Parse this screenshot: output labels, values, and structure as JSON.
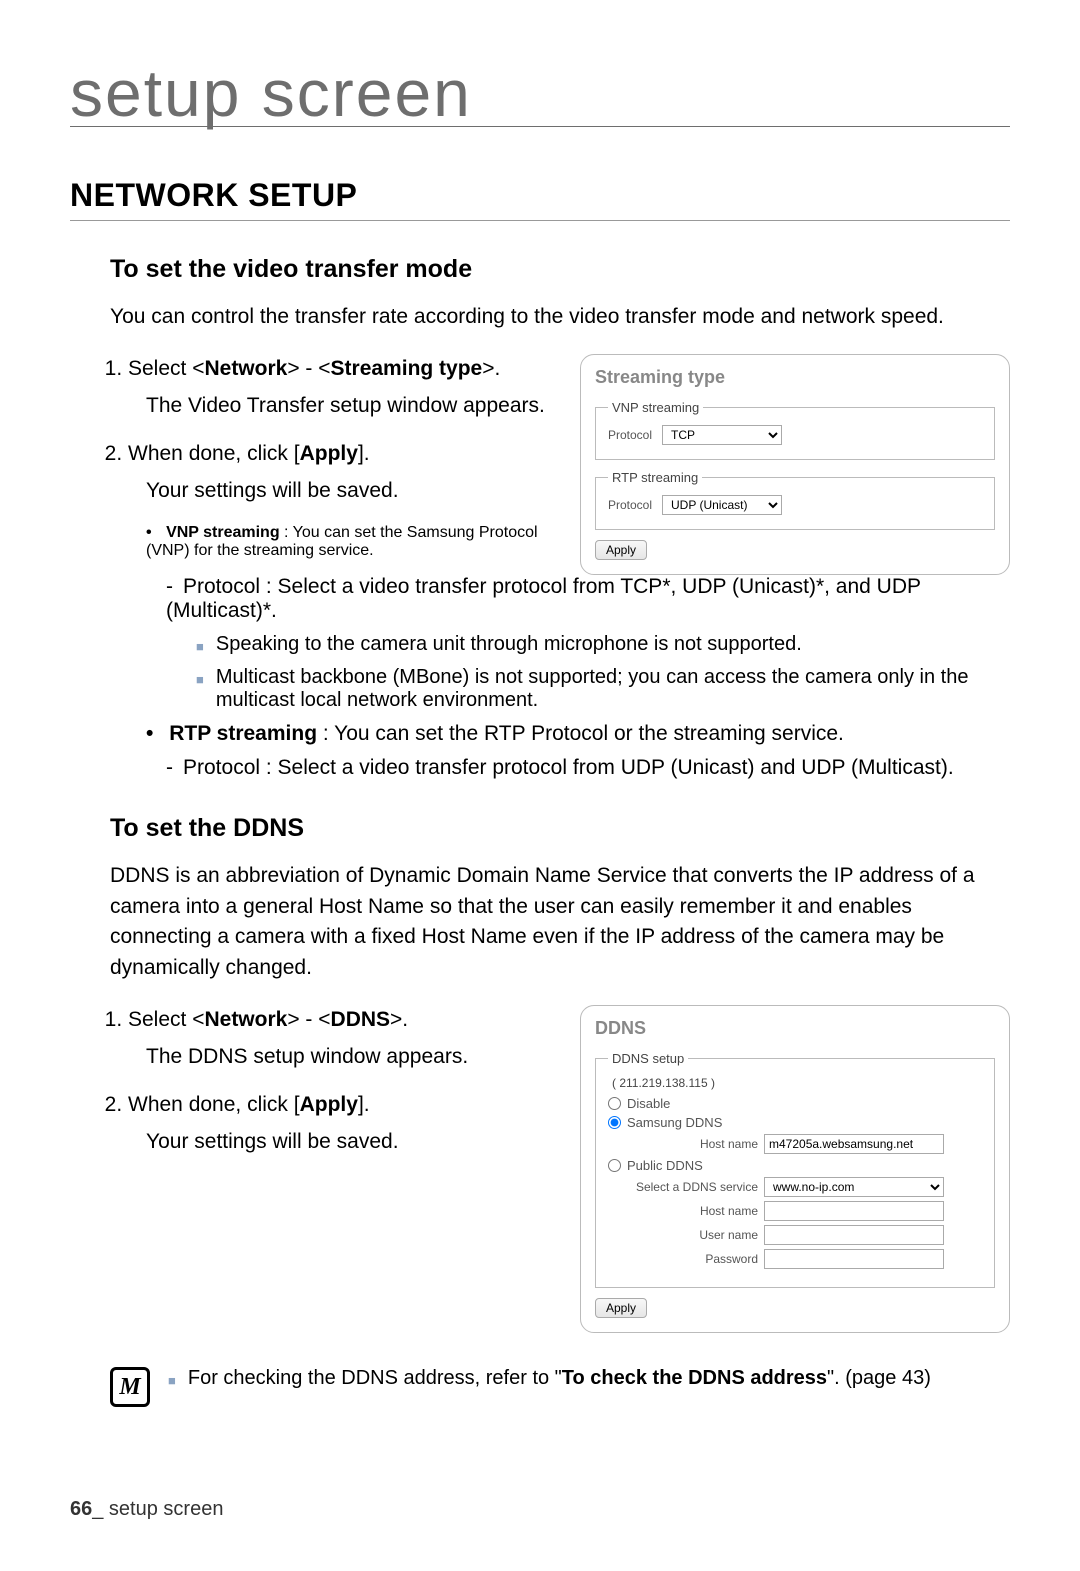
{
  "page": {
    "header": "setup screen",
    "section_title": "NETWORK SETUP",
    "footer_num": "66",
    "footer_text": "_ setup screen"
  },
  "transfer": {
    "title": "To set the video transfer mode",
    "intro": "You can control the transfer rate according to the video transfer mode and network speed.",
    "step1_a": "Select <",
    "step1_b": "Network",
    "step1_c": "> - <",
    "step1_d": "Streaming type",
    "step1_e": ">.",
    "step1_sub": "The Video Transfer setup window appears.",
    "step2_a": "When done, click [",
    "step2_b": "Apply",
    "step2_c": "].",
    "step2_sub": "Your settings will be saved.",
    "vnp_bold": "VNP streaming",
    "vnp_text": " : You can set the Samsung Protocol (VNP) for the streaming service.",
    "vnp_proto": "Protocol : Select a video transfer protocol from TCP*, UDP (Unicast)*, and UDP (Multicast)*.",
    "note1": "Speaking to the camera unit through microphone is not supported.",
    "note2": "Multicast backbone (MBone) is not supported; you can access the camera only in the multicast local network environment.",
    "rtp_bold": "RTP streaming",
    "rtp_text": " : You can set the RTP Protocol or the streaming service.",
    "rtp_proto": "Protocol : Select a video transfer protocol from UDP (Unicast) and UDP (Multicast)."
  },
  "st_panel": {
    "title": "Streaming type",
    "vnp_legend": "VNP streaming",
    "vnp_label": "Protocol",
    "vnp_value": "TCP",
    "rtp_legend": "RTP streaming",
    "rtp_label": "Protocol",
    "rtp_value": "UDP (Unicast)",
    "apply": "Apply"
  },
  "ddns": {
    "title": "To set the DDNS",
    "intro": "DDNS is an abbreviation of Dynamic Domain Name Service that converts the IP address of a camera into a general Host Name so that the user can easily remember it and enables connecting a camera with a fixed Host Name even if the IP address of the camera may be dynamically changed.",
    "step1_a": "Select <",
    "step1_b": "Network",
    "step1_c": "> - <",
    "step1_d": "DDNS",
    "step1_e": ">.",
    "step1_sub": "The DDNS setup window appears.",
    "step2_a": "When done, click [",
    "step2_b": "Apply",
    "step2_c": "].",
    "step2_sub": "Your settings will be saved."
  },
  "ddns_panel": {
    "title": "DDNS",
    "legend": "DDNS setup",
    "ip": "( 211.219.138.115 )",
    "opt_disable": "Disable",
    "opt_samsung": "Samsung DDNS",
    "host_label": "Host name",
    "host_value": "m47205a.websamsung.net",
    "opt_public": "Public DDNS",
    "service_label": "Select a DDNS service",
    "service_value": "www.no-ip.com",
    "host2_label": "Host name",
    "user_label": "User name",
    "pass_label": "Password",
    "apply": "Apply"
  },
  "footnote": {
    "text_a": "For checking the DDNS address, refer to \"",
    "text_b": "To check the DDNS address",
    "text_c": "\". (page 43)"
  }
}
